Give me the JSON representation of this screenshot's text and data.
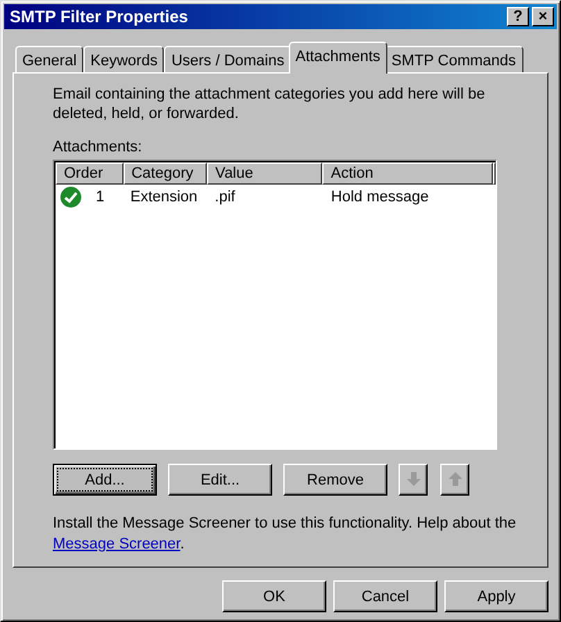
{
  "window": {
    "title": "SMTP Filter Properties",
    "controls": [
      "?",
      "×"
    ]
  },
  "tabs": [
    {
      "label": "General",
      "selected": false
    },
    {
      "label": "Keywords",
      "selected": false
    },
    {
      "label": "Users / Domains",
      "selected": false
    },
    {
      "label": "Attachments",
      "selected": true
    },
    {
      "label": "SMTP Commands",
      "selected": false
    }
  ],
  "description": "Email containing the attachment categories you add here will be deleted, held, or forwarded.",
  "list_label": "Attachments:",
  "table": {
    "columns": [
      "Order",
      "Category",
      "Value",
      "Action"
    ],
    "rows": [
      {
        "enabled": true,
        "order": "1",
        "category": "Extension",
        "value": ".pif",
        "action": "Hold message",
        "selected": false
      }
    ]
  },
  "list_buttons": [
    {
      "kind": "text",
      "label": "Add...",
      "focused": true,
      "disabled": false
    },
    {
      "kind": "text",
      "label": "Edit...",
      "focused": false,
      "disabled": false
    },
    {
      "kind": "text",
      "label": "Remove",
      "focused": false,
      "disabled": false
    },
    {
      "kind": "down",
      "disabled": true
    },
    {
      "kind": "up",
      "disabled": true
    }
  ],
  "help": {
    "text": "Install the Message Screener to use this functionality. Help about the ",
    "link": "Message Screener",
    "suffix": "."
  },
  "buttons": [
    "OK",
    "Cancel",
    "Apply"
  ]
}
